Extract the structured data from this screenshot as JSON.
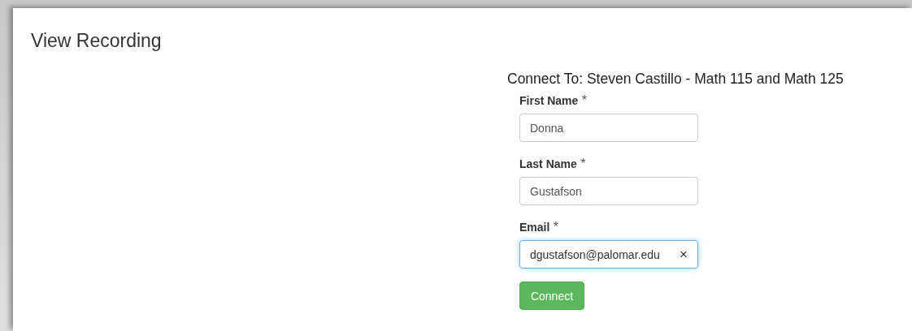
{
  "page": {
    "title": "View Recording"
  },
  "form": {
    "heading": "Connect To: Steven Castillo - Math 115 and Math 125",
    "fields": [
      {
        "label": "First Name",
        "required_mark": "*",
        "value": "Donna",
        "focused": false
      },
      {
        "label": "Last Name",
        "required_mark": "*",
        "value": "Gustafson",
        "focused": false
      },
      {
        "label": "Email",
        "required_mark": "*",
        "value": "dgustafson@palomar.edu",
        "focused": true,
        "clear": "×"
      }
    ],
    "submit": "Connect"
  }
}
